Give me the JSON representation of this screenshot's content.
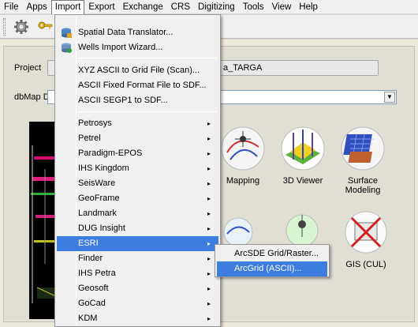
{
  "menubar": {
    "items": [
      "File",
      "Apps",
      "Import",
      "Export",
      "Exchange",
      "CRS",
      "Digitizing",
      "Tools",
      "View",
      "Help"
    ],
    "active": "Import"
  },
  "toolbar": {
    "icons": [
      "gear-icon",
      "key-icon"
    ]
  },
  "main": {
    "project_label": "Project",
    "project_value": "a_TARGA",
    "dbmap_label": "dbMap Da",
    "tiles": [
      {
        "label": "Mapping",
        "icon": "mapping-icon"
      },
      {
        "label": "3D Viewer",
        "icon": "3d-viewer-icon"
      },
      {
        "label": "Surface Modeling",
        "icon": "surface-modeling-icon"
      },
      {
        "label": "GIS (CUL)",
        "icon": "gis-icon"
      }
    ]
  },
  "import_menu": {
    "items": [
      {
        "label": "Spatial Data Translator...",
        "icon": "translator-icon"
      },
      {
        "label": "Wells Import Wizard...",
        "icon": "wells-icon"
      },
      {
        "label": "XYZ ASCII to Grid File (Scan)..."
      },
      {
        "label": "ASCII Fixed Format File to SDF..."
      },
      {
        "label": "ASCII SEGP1 to SDF..."
      },
      {
        "label": "Petrosys",
        "submenu": true
      },
      {
        "label": "Petrel",
        "submenu": true
      },
      {
        "label": "Paradigm-EPOS",
        "submenu": true
      },
      {
        "label": "IHS Kingdom",
        "submenu": true
      },
      {
        "label": "SeisWare",
        "submenu": true
      },
      {
        "label": "GeoFrame",
        "submenu": true
      },
      {
        "label": "Landmark",
        "submenu": true
      },
      {
        "label": "DUG Insight",
        "submenu": true
      },
      {
        "label": "ESRI",
        "submenu": true,
        "highlighted": true
      },
      {
        "label": "Finder",
        "submenu": true
      },
      {
        "label": "IHS Petra",
        "submenu": true
      },
      {
        "label": "Geosoft",
        "submenu": true
      },
      {
        "label": "GoCad",
        "submenu": true
      },
      {
        "label": "KDM",
        "submenu": true
      }
    ]
  },
  "esri_submenu": {
    "items": [
      {
        "label": "ArcSDE Grid/Raster..."
      },
      {
        "label": "ArcGrid (ASCII)...",
        "highlighted": true
      }
    ]
  },
  "submenu_arrow": "▸",
  "colors": {
    "highlight": "#3d7ddf",
    "menu_bg": "#f0f0f0"
  }
}
